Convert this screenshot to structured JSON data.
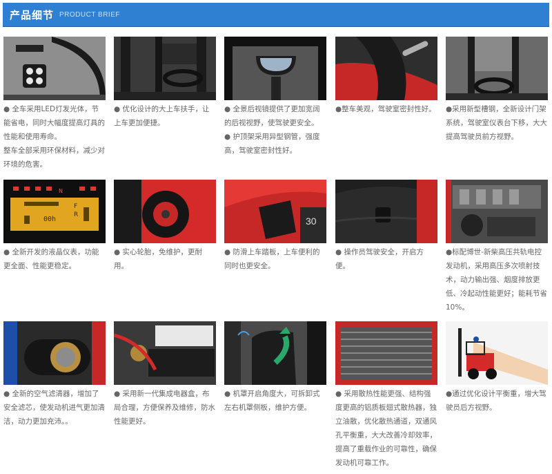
{
  "header": {
    "title_cn": "产品细节",
    "title_en": "PRODUCT BRIEF"
  },
  "items": [
    {
      "lines": [
        "● 全车采用LED灯发光体，节能省电，同时大幅度提高灯具的性能和使用寿命。",
        "整车全部采用环保材料，减少对环境的危害。"
      ]
    },
    {
      "lines": [
        "● 优化设计的大上车扶手，让上车更加便捷。"
      ]
    },
    {
      "lines": [
        "● 全景后视镜提供了更加宽阔的后视视野，使驾驶更安全。",
        "● 护顶架采用异型钢管，强度高，驾驶室密封性好。"
      ]
    },
    {
      "lines": [
        "●整车美观，驾驶室密封性好。"
      ]
    },
    {
      "lines": [
        "●采用新型槽钢，全新设计门架系统，驾驶室仪表台下移，大大提高驾驶员前方视野。"
      ]
    },
    {
      "lines": [
        "● 全新开发的液晶仪表，功能更全面、性能更稳定。"
      ]
    },
    {
      "lines": [
        "● 实心轮胎，免维护，更耐用。"
      ]
    },
    {
      "lines": [
        "● 防滑上车踏板，上车便利的同时也更安全。"
      ]
    },
    {
      "lines": [
        "● 操作员驾驶安全，开启方便。"
      ]
    },
    {
      "lines": [
        "●标配博世-新柴高压共轨电控发动机，采用高压多次喷射技术，动力输出强、烟度排放更低、冷起动性能更好；能耗节省10%。"
      ]
    },
    {
      "lines": [
        "● 全新的空气滤清器，增加了安全滤芯，使发动机进气更加清洁，动力更加充沛。。"
      ]
    },
    {
      "lines": [
        "● 采用新一代集成电器盒，布局合理，方便保养及维修，防水性能更好。"
      ]
    },
    {
      "lines": [
        "● 机罩开启角度大，可拆卸式左右机罩侧板，维护方便。"
      ]
    },
    {
      "lines": [
        "● 采用散热性能更强、结构强度更高的铝质板翅式散热器，独立油散，优化散热通道，双通风孔平衡重，大大改善冷却效率，提高了重载作业的可靠性，确保发动机可靠工作。"
      ]
    },
    {
      "lines": [
        "●通过优化设计平衡重，增大驾驶员后方视野。"
      ]
    }
  ],
  "dashboard": {
    "readout": "00h",
    "gear_n": "N",
    "gear_f": "F",
    "gear_r": "R"
  },
  "cab_label": "30",
  "colors": {
    "header_bg": "#2f7fd3",
    "body_text": "#666666",
    "brand_red": "#d42a2a"
  }
}
